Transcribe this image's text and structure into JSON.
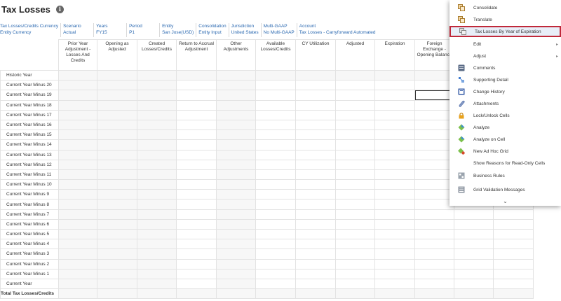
{
  "header": {
    "title": "Tax Losses",
    "info_glyph": "i"
  },
  "pov": [
    {
      "label": "Tax Losses/Credits Currency",
      "value": "Entity Currency"
    },
    {
      "label": "Scenario",
      "value": "Actual"
    },
    {
      "label": "Years",
      "value": "FY15"
    },
    {
      "label": "Period",
      "value": "P1"
    },
    {
      "label": "Entity",
      "value": "San Jose(USD)"
    },
    {
      "label": "Consolidation",
      "value": "Entity Input"
    },
    {
      "label": "Jurisdiction",
      "value": "United States"
    },
    {
      "label": "Multi-GAAP",
      "value": "No Multi-GAAP"
    },
    {
      "label": "Account",
      "value": "Tax Losses - Carryforward Automated"
    }
  ],
  "grid": {
    "columns": [
      "Prior Year Adjustment - Losses And Credits",
      "Opening as Adjusted",
      "Created Losses/Credits",
      "Return to Accrual Adjustment",
      "Other Adjustments",
      "Available Losses/Credits",
      "CY Utilization",
      "Adjusted",
      "Expiration",
      "Foreign Exchange - Opening Balance",
      "",
      ""
    ],
    "rows": [
      "Historic Year",
      "Current Year Minus 20",
      "Current Year Minus 19",
      "Current Year Minus 18",
      "Current Year Minus 17",
      "Current Year Minus 16",
      "Current Year Minus 15",
      "Current Year Minus 14",
      "Current Year Minus 13",
      "Current Year Minus 12",
      "Current Year Minus 11",
      "Current Year Minus 10",
      "Current Year Minus 9",
      "Current Year Minus 8",
      "Current Year Minus 7",
      "Current Year Minus 6",
      "Current Year Minus 5",
      "Current Year Minus 4",
      "Current Year Minus 3",
      "Current Year Minus 2",
      "Current Year Minus 1",
      "Current Year",
      "Total Tax Losses/Credits"
    ]
  },
  "context_menu": {
    "items": [
      {
        "label": "Consolidate",
        "icon": "consolidate-icon",
        "submenu": false,
        "highlighted": false
      },
      {
        "label": "Translate",
        "icon": "translate-icon",
        "submenu": false,
        "highlighted": false
      },
      {
        "label": "Tax Losses By Year of Expiration",
        "icon": "tax-losses-form-icon",
        "submenu": false,
        "highlighted": true
      },
      {
        "label": "Edit",
        "icon": "",
        "submenu": true,
        "highlighted": false
      },
      {
        "label": "Adjust",
        "icon": "",
        "submenu": true,
        "highlighted": false
      },
      {
        "label": "Comments",
        "icon": "comments-icon",
        "submenu": false,
        "highlighted": false
      },
      {
        "label": "Supporting Detail",
        "icon": "supporting-detail-icon",
        "submenu": false,
        "highlighted": false
      },
      {
        "label": "Change History",
        "icon": "change-history-icon",
        "submenu": false,
        "highlighted": false
      },
      {
        "label": "Attachments",
        "icon": "attachments-icon",
        "submenu": false,
        "highlighted": false
      },
      {
        "label": "Lock/Unlock Cells",
        "icon": "lock-icon",
        "submenu": false,
        "highlighted": false
      },
      {
        "label": "Analyze",
        "icon": "analyze-icon",
        "submenu": false,
        "highlighted": false
      },
      {
        "label": "Analyze on Cell",
        "icon": "analyze-cell-icon",
        "submenu": false,
        "highlighted": false
      },
      {
        "label": "New Ad Hoc Grid",
        "icon": "ad-hoc-grid-icon",
        "submenu": false,
        "highlighted": false
      },
      {
        "label": "Show Reasons for Read-Only Cells",
        "icon": "",
        "submenu": false,
        "highlighted": false
      },
      {
        "label": "Business Rules",
        "icon": "business-rules-icon",
        "submenu": false,
        "highlighted": false
      },
      {
        "label": "Grid Validation Messages",
        "icon": "grid-validation-icon",
        "submenu": false,
        "highlighted": false
      }
    ],
    "scroll_glyph": "⌄"
  },
  "colors": {
    "link_blue": "#2a68b0",
    "menu_highlight_border": "#c0283a",
    "cell_readonly": "#f7f7f7"
  }
}
